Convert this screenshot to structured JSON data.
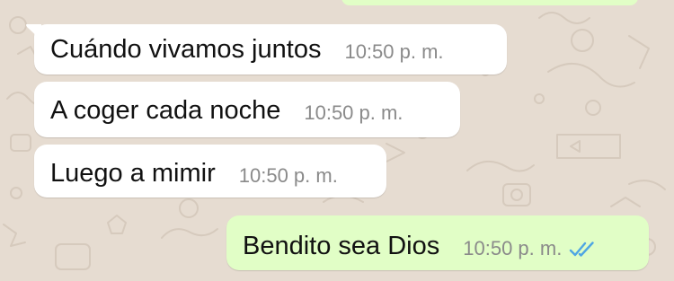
{
  "colors": {
    "wallpaper": "#e6dcd1",
    "incoming_bubble": "#ffffff",
    "outgoing_bubble": "#e1fec6",
    "text": "#111111",
    "timestamp": "#8a8a8a",
    "read_ticks": "#4fa6e3"
  },
  "messages": [
    {
      "direction": "incoming",
      "text": "Cuándo vivamos juntos",
      "time": "10:50 p. m."
    },
    {
      "direction": "incoming",
      "text": "A coger cada noche",
      "time": "10:50 p. m."
    },
    {
      "direction": "incoming",
      "text": "Luego a mimir",
      "time": "10:50 p. m."
    },
    {
      "direction": "outgoing",
      "text": "Bendito sea Dios",
      "time": "10:50 p. m.",
      "status_icon": "double-check-read-icon"
    }
  ]
}
